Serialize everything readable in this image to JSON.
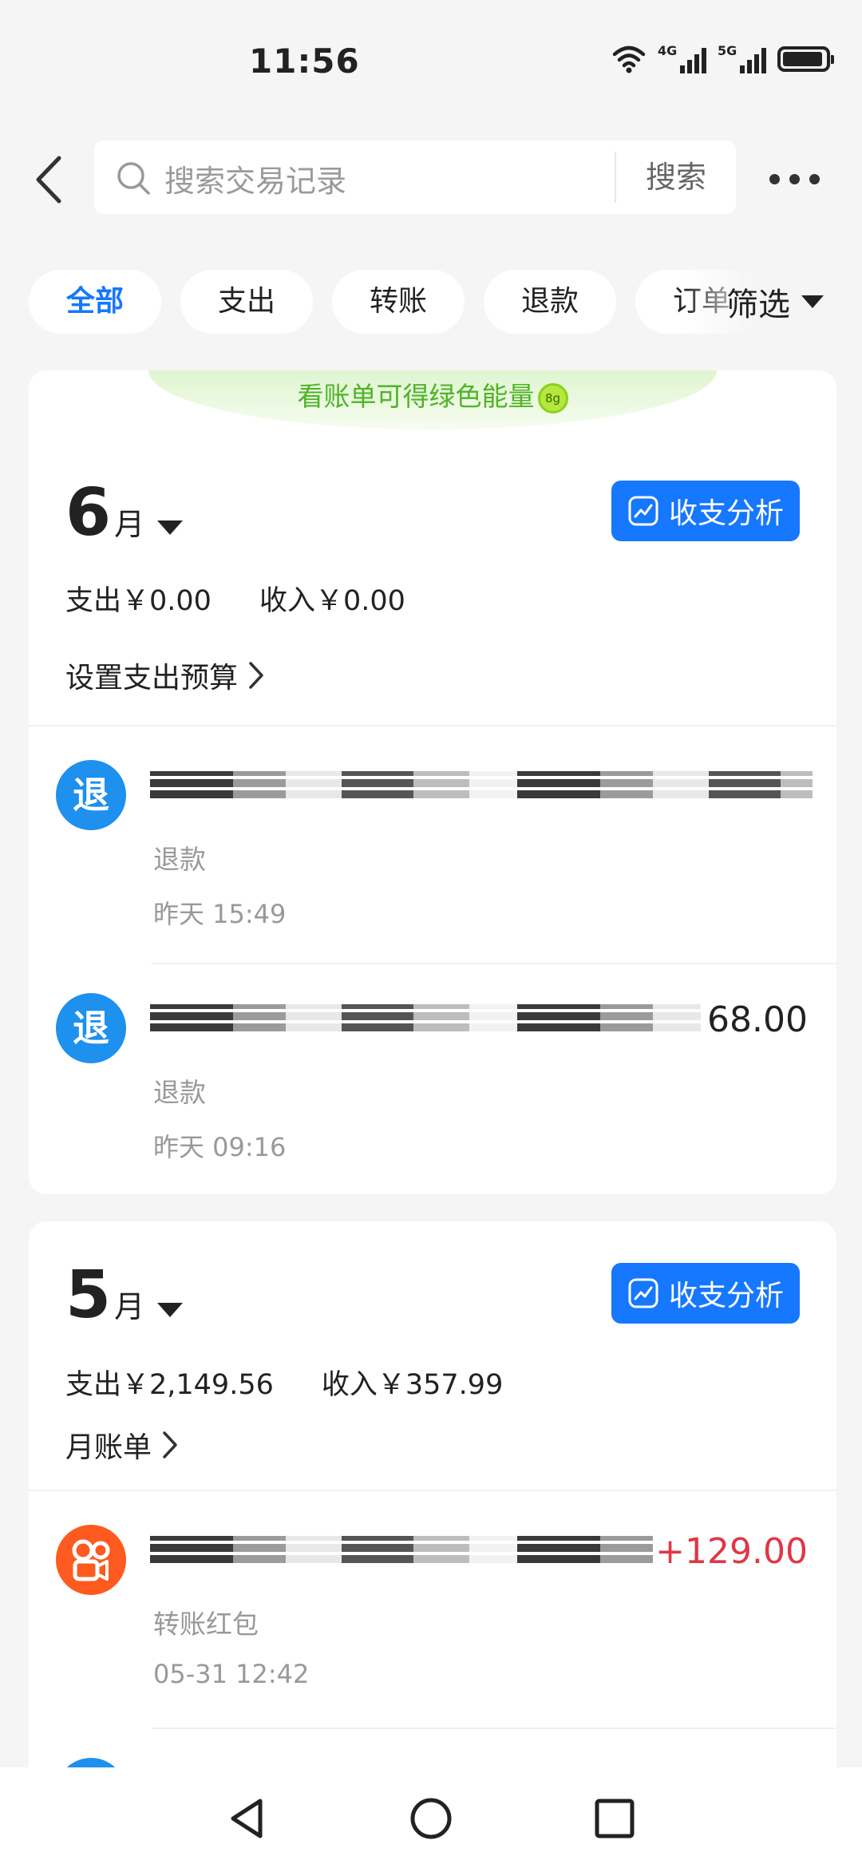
{
  "status_bar": {
    "time": "11:56",
    "net1": "4G",
    "net2": "5G",
    "battery_level": 0.95
  },
  "header": {
    "search_placeholder": "搜索交易记录",
    "search_button": "搜索"
  },
  "tabs": [
    {
      "label": "全部",
      "active": true
    },
    {
      "label": "支出",
      "active": false
    },
    {
      "label": "转账",
      "active": false
    },
    {
      "label": "退款",
      "active": false
    },
    {
      "label": "订单",
      "active": false
    }
  ],
  "filter_label": "筛选",
  "colors": {
    "accent": "#1677ff",
    "income": "#e03646",
    "energy_green": "#4fb428"
  },
  "months": [
    {
      "banner": "看账单可得绿色能量",
      "energy_badge": "8g",
      "month_num": "6",
      "month_unit": "月",
      "analysis_label": "收支分析",
      "expense": "支出￥0.00",
      "income": "收入￥0.00",
      "link": "设置支出预算",
      "transactions": [
        {
          "icon": "退",
          "icon_name": "refund-icon",
          "amount": "",
          "type": "退款",
          "time": "昨天 15:49"
        },
        {
          "icon": "退",
          "icon_name": "refund-icon",
          "amount": "68.00",
          "type": "退款",
          "time": "昨天 09:16"
        }
      ]
    },
    {
      "month_num": "5",
      "month_unit": "月",
      "analysis_label": "收支分析",
      "expense": "支出￥2,149.56",
      "income": "收入￥357.99",
      "link": "月账单",
      "transactions": [
        {
          "icon": "",
          "icon_name": "kuaishou-icon",
          "amount": "+129.00",
          "type": "转账红包",
          "time": "05-31 12:42"
        }
      ]
    }
  ]
}
